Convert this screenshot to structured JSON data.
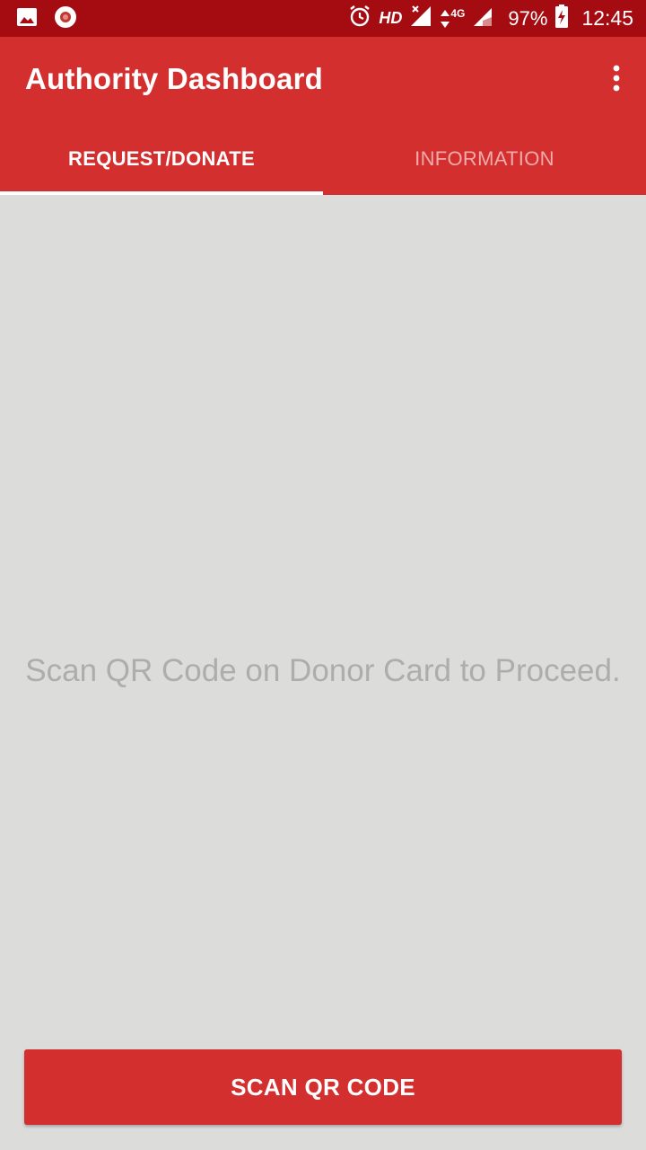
{
  "status_bar": {
    "left_icons": [
      "image-icon",
      "record-icon"
    ],
    "right_icons": [
      "alarm-icon",
      "signal-icon",
      "data-arrows-icon",
      "signal-icon",
      "battery-charging-icon"
    ],
    "hd_label": "HD",
    "network_label": "4G",
    "battery_text": "97%",
    "time": "12:45"
  },
  "app_bar": {
    "title": "Authority Dashboard",
    "menu_icon": "more-vert-icon"
  },
  "tabs": [
    {
      "label": "REQUEST/DONATE",
      "selected": true
    },
    {
      "label": "INFORMATION",
      "selected": false
    }
  ],
  "main": {
    "message": "Scan QR Code on Donor Card to Proceed."
  },
  "actions": {
    "scan_button_label": "SCAN QR CODE"
  },
  "colors": {
    "status_bar": "#a40c12",
    "primary": "#d32f2f",
    "background": "#dcdcdb",
    "message_text": "#adadad",
    "inactive_tab": "#f2aaaa"
  }
}
